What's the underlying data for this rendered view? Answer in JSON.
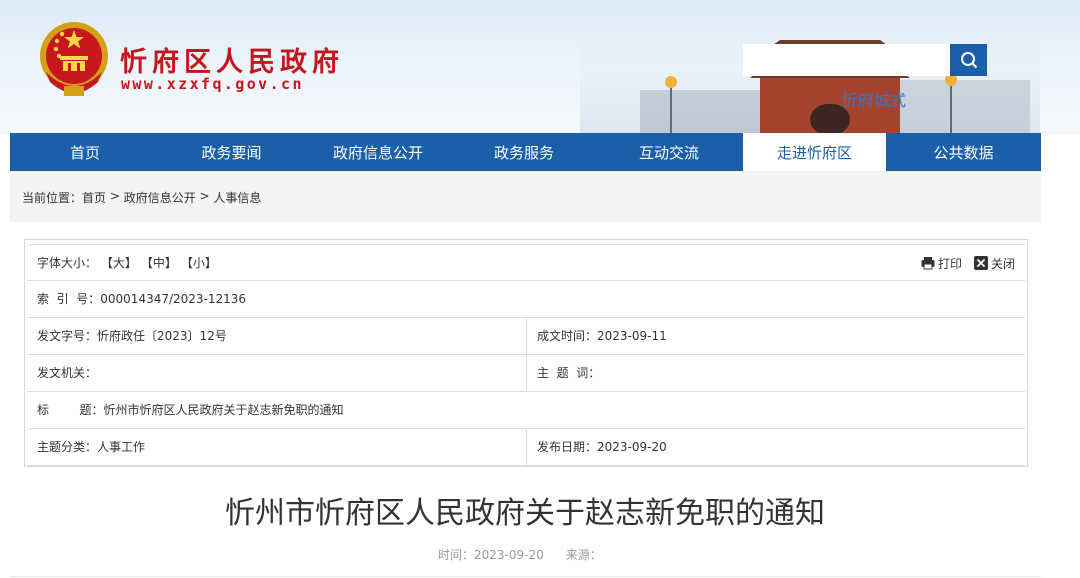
{
  "header": {
    "site_name": "忻府区人民政府",
    "site_url": "www.xzxfq.gov.cn",
    "scenery_caption": "忻府城式",
    "search_placeholder": ""
  },
  "nav": {
    "items": [
      {
        "label": "首页",
        "active": false
      },
      {
        "label": "政务要闻",
        "active": false
      },
      {
        "label": "政府信息公开",
        "active": false
      },
      {
        "label": "政务服务",
        "active": false
      },
      {
        "label": "互动交流",
        "active": false
      },
      {
        "label": "走进忻府区",
        "active": true
      },
      {
        "label": "公共数据",
        "active": false
      }
    ]
  },
  "breadcrumb": {
    "prefix": "当前位置：",
    "items": [
      "首页",
      "政府信息公开",
      "人事信息"
    ],
    "separator": " > "
  },
  "info": {
    "font_size_label": "字体大小：",
    "font_large": "【大】",
    "font_medium": "【中】",
    "font_small": "【小】",
    "print_label": "打印",
    "close_label": "关闭",
    "index_label": "索  引  号：",
    "index_value": "000014347/2023-12136",
    "doc_no_label": "发文字号：",
    "doc_no_value": "忻府政任〔2023〕12号",
    "date_written_label": "成文时间：",
    "date_written_value": "2023-09-11",
    "issuer_label": "发文机关：",
    "issuer_value": "",
    "keywords_label": "主  题  词：",
    "keywords_value": "",
    "title_label": "标        题：",
    "title_value": "忻州市忻府区人民政府关于赵志新免职的通知",
    "category_label": "主题分类：",
    "category_value": "人事工作",
    "publish_date_label": "发布日期：",
    "publish_date_value": "2023-09-20"
  },
  "article": {
    "title": "忻州市忻府区人民政府关于赵志新免职的通知",
    "time_label": "时间：",
    "time_value": "2023-09-20",
    "source_label": "来源：",
    "source_value": ""
  },
  "colors": {
    "brand_red": "#c4161c",
    "nav_blue": "#1a5fa8"
  }
}
